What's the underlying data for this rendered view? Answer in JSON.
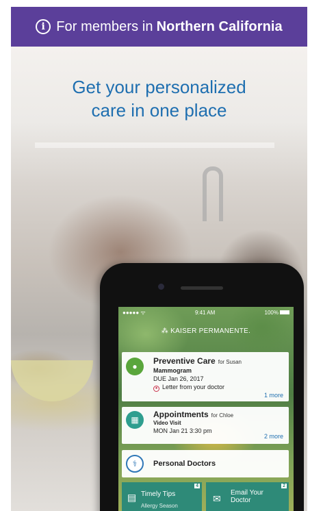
{
  "banner": {
    "prefix": "For members in",
    "region": "Northern California",
    "icon": "info-icon"
  },
  "headline": {
    "line1": "Get your personalized",
    "line2": "care in one place"
  },
  "phone": {
    "status": {
      "signal": "●●●●● ",
      "wifi": "ᯤ",
      "time": "9:41 AM",
      "battery": "100%"
    },
    "brand": "KAISER PERMANENTE.",
    "preventive": {
      "title": "Preventive Care",
      "for": "for Susan",
      "item": "Mammogram",
      "due": "DUE Jan 26, 2017",
      "reminder": "Letter from your doctor",
      "more": "1 more"
    },
    "appointments": {
      "title": "Appointments",
      "for": "for Chloe",
      "type": "Video Visit",
      "when": "MON Jan 21 3:30 pm",
      "more": "2 more"
    },
    "doctors": {
      "title": "Personal Doctors"
    },
    "tips": {
      "title": "Timely Tips",
      "subtitle": "Allergy Season",
      "badge": "4"
    },
    "email": {
      "title_line1": "Email Your",
      "title_line2": "Doctor",
      "badge": "2"
    }
  },
  "colors": {
    "banner": "#5b3f9a",
    "headline": "#1f6fb0",
    "tile": "#2e8a78"
  }
}
